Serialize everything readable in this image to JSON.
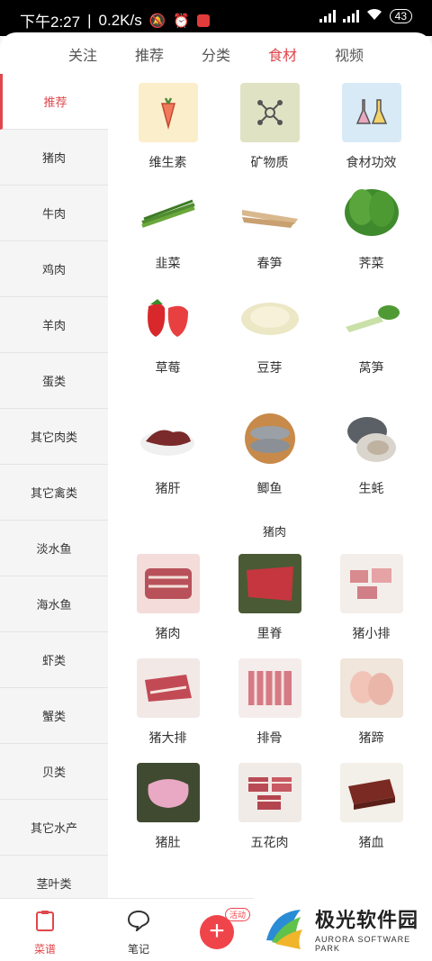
{
  "status": {
    "time": "下午2:27",
    "speed": "0.2K/s",
    "battery": "43"
  },
  "tabs": [
    {
      "label": "关注"
    },
    {
      "label": "推荐"
    },
    {
      "label": "分类"
    },
    {
      "label": "食材"
    },
    {
      "label": "视频"
    }
  ],
  "active_tab": "食材",
  "sidebar": {
    "items": [
      {
        "label": "推荐"
      },
      {
        "label": "猪肉"
      },
      {
        "label": "牛肉"
      },
      {
        "label": "鸡肉"
      },
      {
        "label": "羊肉"
      },
      {
        "label": "蛋类"
      },
      {
        "label": "其它肉类"
      },
      {
        "label": "其它禽类"
      },
      {
        "label": "淡水鱼"
      },
      {
        "label": "海水鱼"
      },
      {
        "label": "虾类"
      },
      {
        "label": "蟹类"
      },
      {
        "label": "贝类"
      },
      {
        "label": "其它水产"
      },
      {
        "label": "茎叶类"
      }
    ]
  },
  "recommend": {
    "categories": [
      {
        "label": "维生素",
        "icon": "carrot-icon",
        "bg": "#fbeecb"
      },
      {
        "label": "矿物质",
        "icon": "molecule-icon",
        "bg": "#dfe3c3"
      },
      {
        "label": "食材功效",
        "icon": "flask-icon",
        "bg": "#d8eaf6"
      }
    ],
    "items": [
      {
        "label": "韭菜"
      },
      {
        "label": "春笋"
      },
      {
        "label": "荠菜"
      },
      {
        "label": "草莓"
      },
      {
        "label": "豆芽"
      },
      {
        "label": "莴笋"
      },
      {
        "label": "猪肝"
      },
      {
        "label": "鲫鱼"
      },
      {
        "label": "生蚝"
      }
    ]
  },
  "pork": {
    "title": "猪肉",
    "items": [
      {
        "label": "猪肉"
      },
      {
        "label": "里脊"
      },
      {
        "label": "猪小排"
      },
      {
        "label": "猪大排"
      },
      {
        "label": "排骨"
      },
      {
        "label": "猪蹄"
      },
      {
        "label": "猪肚"
      },
      {
        "label": "五花肉"
      },
      {
        "label": "猪血"
      }
    ]
  },
  "bottom_nav": {
    "recipes": "菜谱",
    "notes": "笔记",
    "badge": "活动"
  },
  "watermark": {
    "cn": "极光软件园",
    "en": "AURORA SOFTWARE PARK"
  },
  "colors": {
    "accent": "#e0474c"
  }
}
